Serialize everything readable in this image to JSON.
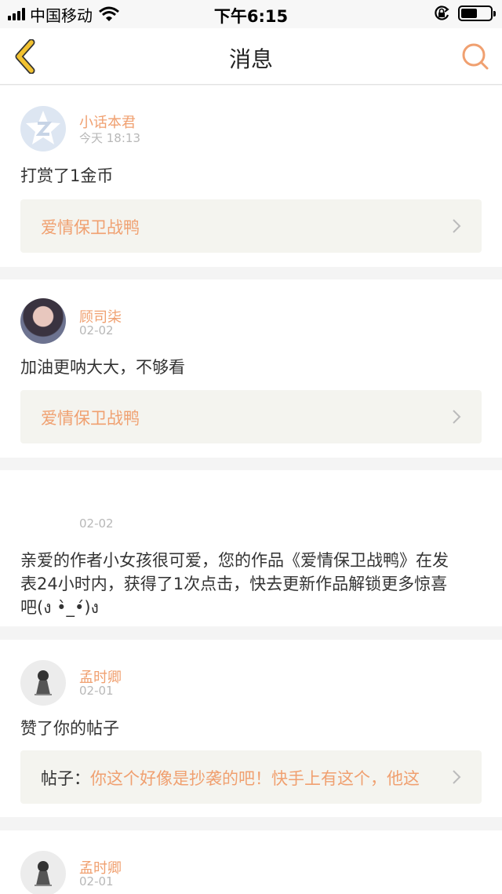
{
  "status_bar": {
    "carrier": "中国移动",
    "time": "下午6:15",
    "battery_level": 0.55
  },
  "nav": {
    "title": "消息"
  },
  "messages": [
    {
      "name": "小话本君",
      "time": "今天 18:13",
      "text": "打赏了1金币",
      "link_prefix": "",
      "link": "爱情保卫战鸭",
      "avatar": "qq-logo-avatar"
    },
    {
      "name": "顾司柒",
      "time": "02-02",
      "text": "加油更呐大大，不够看",
      "link_prefix": "",
      "link": "爱情保卫战鸭",
      "avatar": "girl-portrait-avatar"
    },
    {
      "name": "",
      "time": "02-02",
      "text_lines": [
        "亲爱的作者小女孩很可爱，您的作品《爱情保卫战鸭》在发",
        "表24小时内，获得了1次点击，快去更新作品解锁更多惊喜",
        "吧(ง •̀_•́)ง"
      ]
    },
    {
      "name": "孟时卿",
      "time": "02-01",
      "text": "赞了你的帖子",
      "link_prefix": "帖子：",
      "link": "你这个好像是抄袭的吧！快手上有这个，他这",
      "avatar": "girl-sketch-avatar"
    },
    {
      "name": "孟时卿",
      "time": "02-01",
      "avatar": "girl-sketch-avatar"
    }
  ],
  "colors": {
    "accent": "#f0a070",
    "back_icon": "#f2c230",
    "link_bg": "#f4f4ef",
    "page_bg": "#f4f4f4"
  }
}
